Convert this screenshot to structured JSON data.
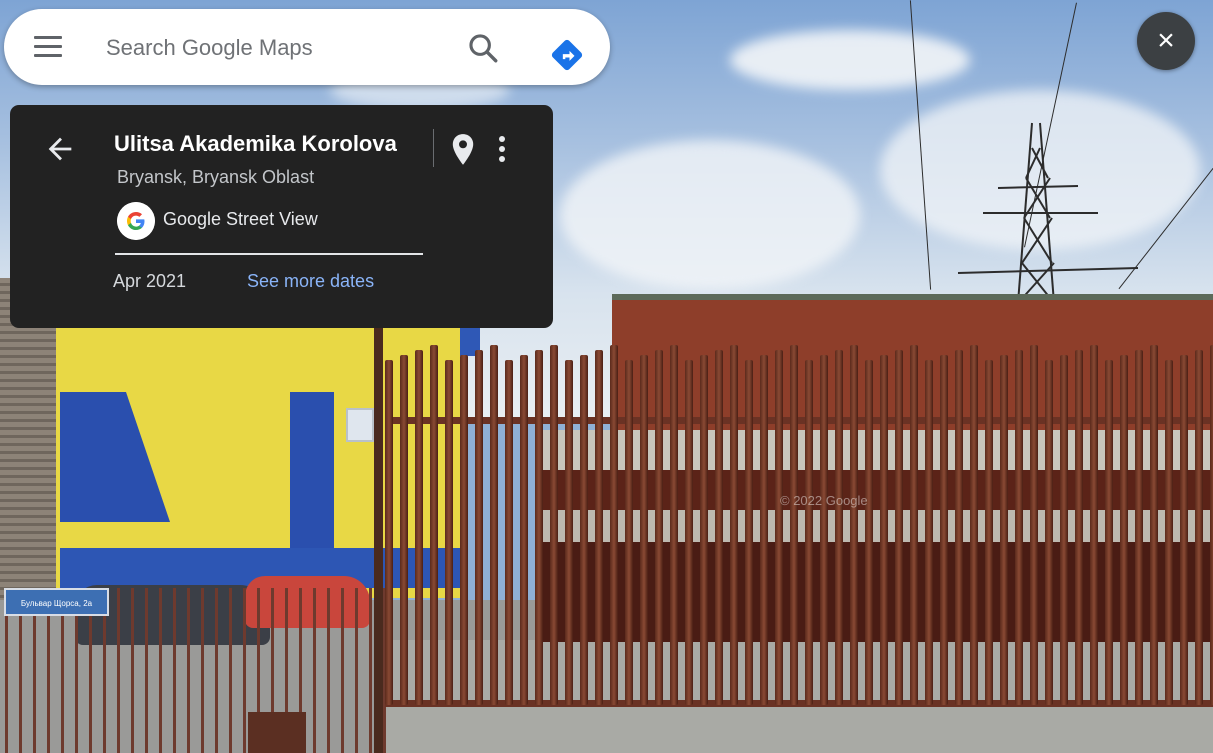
{
  "search": {
    "placeholder": "Search Google Maps",
    "value": ""
  },
  "info_card": {
    "title": "Ulitsa Akademika Korolova",
    "subtitle": "Bryansk, Bryansk Oblast",
    "source": "Google Street View",
    "date": "Apr 2021",
    "more_dates_link": "See more dates"
  },
  "close_button": {
    "label": "×"
  },
  "scene": {
    "sign_text": "Бульвар Щорса, 2а",
    "watermark": "© 2022 Google"
  },
  "icons": {
    "menu": "hamburger-menu-icon",
    "search": "search-icon",
    "directions": "directions-icon",
    "back": "arrow-back-icon",
    "pin": "map-pin-icon",
    "more": "more-vert-icon",
    "google": "google-logo-icon",
    "close": "close-icon"
  },
  "colors": {
    "card_background": "#222222",
    "link": "#8ab4f8",
    "directions": "#1a73e8",
    "close_button": "#3c4043"
  }
}
